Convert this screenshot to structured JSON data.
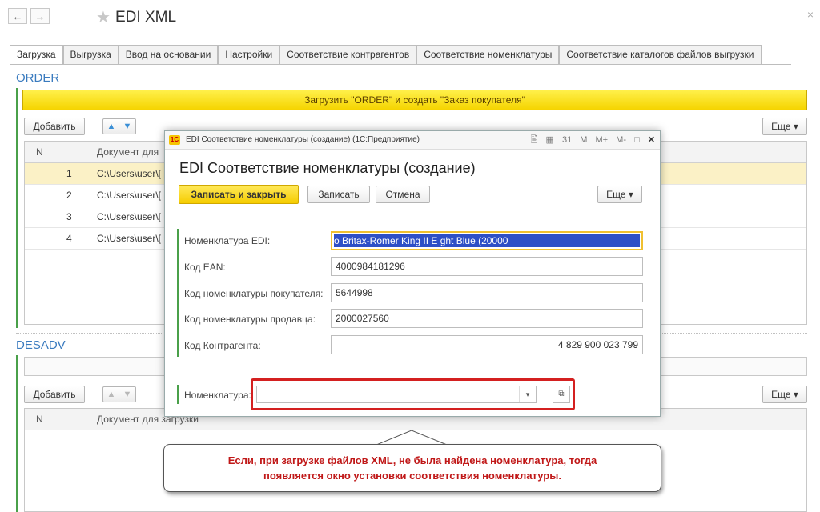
{
  "window": {
    "title": "EDI XML",
    "close_label": "×"
  },
  "nav": {
    "back": "←",
    "forward": "→",
    "star": "★"
  },
  "tabs": [
    "Загрузка",
    "Выгрузка",
    "Ввод на основании",
    "Настройки",
    "Соответствие контрагентов",
    "Соответствие номенклатуры",
    "Соответствие каталогов файлов выгрузки"
  ],
  "order": {
    "section_title": "ORDER",
    "load_button": "Загрузить \"ORDER\" и создать \"Заказ покупателя\"",
    "add_button": "Добавить",
    "more_button": "Еще ▾",
    "columns": [
      "N",
      "Документ для"
    ],
    "rows": [
      {
        "n": "1",
        "doc": "C:\\Users\\user\\[",
        "selected": true
      },
      {
        "n": "2",
        "doc": "C:\\Users\\user\\[",
        "selected": false
      },
      {
        "n": "3",
        "doc": "C:\\Users\\user\\[",
        "selected": false
      },
      {
        "n": "4",
        "doc": "C:\\Users\\user\\[",
        "selected": false
      }
    ]
  },
  "desadv": {
    "section_title": "DESADV",
    "add_button": "Добавить",
    "more_button": "Еще ▾",
    "columns": [
      "N",
      "Документ для загрузки"
    ]
  },
  "modal": {
    "window_title": "EDI Соответствие номенклатуры (создание)  (1С:Предприятие)",
    "logo": "1С",
    "heading": "EDI Соответствие номенклатуры (создание)",
    "save_close": "Записать и закрыть",
    "save": "Записать",
    "cancel": "Отмена",
    "more": "Еще ▾",
    "title_icons": [
      "🖹",
      "▦",
      "31",
      "M",
      "M+",
      "M-",
      "□",
      "✕"
    ],
    "fields": {
      "edi_label": "Номенклатура EDI:",
      "edi_value": "o Britax-Romer King II E                    ght Blue (20000",
      "ean_label": "Код EAN:",
      "ean_value": "4000984181296",
      "buyer_label": "Код номенклатуры покупателя:",
      "buyer_value": "5644998",
      "seller_label": "Код номенклатуры продавца:",
      "seller_value": "2000027560",
      "contractor_label": "Код Контрагента:",
      "contractor_value": "4 829 900 023 799",
      "nom_label": "Номенклатура:",
      "nom_value": ""
    }
  },
  "callout": {
    "line1": "Если, при загрузке файлов XML, не была найдена номенклатура, тогда",
    "line2": "появляется окно установки соответствия номенклатуры."
  }
}
